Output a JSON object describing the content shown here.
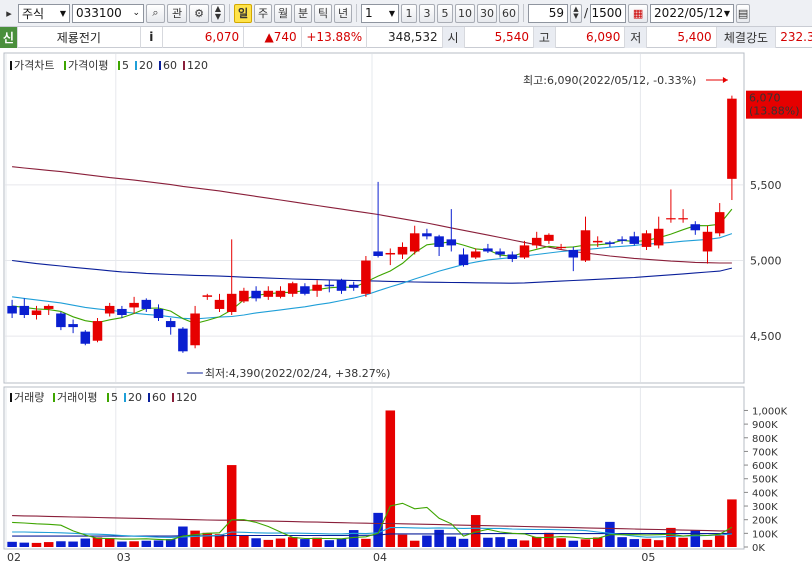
{
  "toolbar": {
    "market": "주식",
    "code": "033100",
    "btn_gwan": "관",
    "period_tabs": [
      {
        "label": "일",
        "active": true
      },
      {
        "label": "주",
        "active": false
      },
      {
        "label": "월",
        "active": false
      },
      {
        "label": "분",
        "active": false
      },
      {
        "label": "틱",
        "active": false
      },
      {
        "label": "년",
        "active": false
      }
    ],
    "interval": "1",
    "quick_counts": [
      "1",
      "3",
      "5",
      "10",
      "30",
      "60"
    ],
    "display_count": "59",
    "total_count": "1500",
    "date": "2022/05/12"
  },
  "quote": {
    "tag": "신",
    "name": "제룡전기",
    "info_btn": "i",
    "price": "6,070",
    "change": "▲740",
    "change_pct": "+13.88%",
    "volume": "348,532",
    "open_label": "시",
    "open": "5,540",
    "high_label": "고",
    "high": "6,090",
    "low_label": "저",
    "low": "5,400",
    "strength_label": "체결강도",
    "strength": "232.3"
  },
  "colors": {
    "up": "#e60000",
    "down": "#0a1fd0",
    "ma5": "#3ea500",
    "ma20": "#1f9fd8",
    "ma60": "#0a1f9a",
    "ma120": "#8a1f3a"
  },
  "chart_data": [
    {
      "type": "candlestick",
      "title": "가격차트",
      "legend": [
        {
          "name": "가격이평",
          "color": "#3ea500"
        },
        {
          "name": "5",
          "color": "#3ea500"
        },
        {
          "name": "20",
          "color": "#1f9fd8"
        },
        {
          "name": "60",
          "color": "#0a1f9a"
        },
        {
          "name": "120",
          "color": "#8a1f3a"
        }
      ],
      "y_ticks": [
        "5,500",
        "5,000",
        "4,500"
      ],
      "y_tick_values": [
        5500,
        5000,
        4500
      ],
      "ylim": [
        4250,
        6200
      ],
      "x_ticks": [
        {
          "label": "02",
          "index": 0
        },
        {
          "label": "03",
          "index": 9
        },
        {
          "label": "04",
          "index": 30
        },
        {
          "label": "05",
          "index": 52
        }
      ],
      "annotations": {
        "high": "최고:6,090(2022/05/12, -0.33%)",
        "low": "최저:4,390(2022/02/24, +38.27%)",
        "last_price": "6,070",
        "last_pct": "(13.88%)"
      },
      "candles": [
        {
          "o": 4700,
          "h": 4740,
          "l": 4620,
          "c": 4650
        },
        {
          "o": 4700,
          "h": 4750,
          "l": 4620,
          "c": 4640
        },
        {
          "o": 4640,
          "h": 4700,
          "l": 4610,
          "c": 4670
        },
        {
          "o": 4680,
          "h": 4710,
          "l": 4640,
          "c": 4700
        },
        {
          "o": 4650,
          "h": 4660,
          "l": 4540,
          "c": 4560
        },
        {
          "o": 4580,
          "h": 4610,
          "l": 4520,
          "c": 4560
        },
        {
          "o": 4530,
          "h": 4540,
          "l": 4440,
          "c": 4450
        },
        {
          "o": 4470,
          "h": 4620,
          "l": 4460,
          "c": 4600
        },
        {
          "o": 4650,
          "h": 4720,
          "l": 4630,
          "c": 4700
        },
        {
          "o": 4680,
          "h": 4700,
          "l": 4620,
          "c": 4640
        },
        {
          "o": 4690,
          "h": 4760,
          "l": 4650,
          "c": 4720
        },
        {
          "o": 4740,
          "h": 4750,
          "l": 4660,
          "c": 4680
        },
        {
          "o": 4680,
          "h": 4710,
          "l": 4600,
          "c": 4620
        },
        {
          "o": 4600,
          "h": 4620,
          "l": 4510,
          "c": 4560
        },
        {
          "o": 4550,
          "h": 4560,
          "l": 4390,
          "c": 4400
        },
        {
          "o": 4440,
          "h": 4700,
          "l": 4420,
          "c": 4650
        },
        {
          "o": 4760,
          "h": 4780,
          "l": 4740,
          "c": 4770
        },
        {
          "o": 4680,
          "h": 4780,
          "l": 4660,
          "c": 4740
        },
        {
          "o": 4660,
          "h": 5140,
          "l": 4640,
          "c": 4780
        },
        {
          "o": 4730,
          "h": 4820,
          "l": 4720,
          "c": 4800
        },
        {
          "o": 4800,
          "h": 4830,
          "l": 4730,
          "c": 4750
        },
        {
          "o": 4760,
          "h": 4830,
          "l": 4740,
          "c": 4800
        },
        {
          "o": 4760,
          "h": 4830,
          "l": 4750,
          "c": 4800
        },
        {
          "o": 4780,
          "h": 4860,
          "l": 4760,
          "c": 4850
        },
        {
          "o": 4830,
          "h": 4850,
          "l": 4770,
          "c": 4780
        },
        {
          "o": 4800,
          "h": 4870,
          "l": 4760,
          "c": 4840
        },
        {
          "o": 4840,
          "h": 4870,
          "l": 4790,
          "c": 4830
        },
        {
          "o": 4870,
          "h": 4880,
          "l": 4780,
          "c": 4800
        },
        {
          "o": 4840,
          "h": 4860,
          "l": 4800,
          "c": 4820
        },
        {
          "o": 4780,
          "h": 5030,
          "l": 4760,
          "c": 5000
        },
        {
          "o": 5060,
          "h": 5520,
          "l": 5020,
          "c": 5030
        },
        {
          "o": 5040,
          "h": 5080,
          "l": 4970,
          "c": 5050
        },
        {
          "o": 5040,
          "h": 5120,
          "l": 5010,
          "c": 5090
        },
        {
          "o": 5060,
          "h": 5230,
          "l": 5040,
          "c": 5180
        },
        {
          "o": 5180,
          "h": 5210,
          "l": 5140,
          "c": 5160
        },
        {
          "o": 5160,
          "h": 5170,
          "l": 5030,
          "c": 5090
        },
        {
          "o": 5140,
          "h": 5340,
          "l": 5060,
          "c": 5100
        },
        {
          "o": 5040,
          "h": 5080,
          "l": 4960,
          "c": 4970
        },
        {
          "o": 5020,
          "h": 5080,
          "l": 5010,
          "c": 5060
        },
        {
          "o": 5080,
          "h": 5110,
          "l": 5050,
          "c": 5060
        },
        {
          "o": 5060,
          "h": 5080,
          "l": 5020,
          "c": 5040
        },
        {
          "o": 5040,
          "h": 5060,
          "l": 4990,
          "c": 5010
        },
        {
          "o": 5020,
          "h": 5130,
          "l": 5010,
          "c": 5100
        },
        {
          "o": 5100,
          "h": 5190,
          "l": 5080,
          "c": 5150
        },
        {
          "o": 5130,
          "h": 5180,
          "l": 5110,
          "c": 5170
        },
        {
          "o": 5090,
          "h": 5110,
          "l": 5070,
          "c": 5090
        },
        {
          "o": 5070,
          "h": 5090,
          "l": 4930,
          "c": 5020
        },
        {
          "o": 5000,
          "h": 5290,
          "l": 4990,
          "c": 5200
        },
        {
          "o": 5120,
          "h": 5160,
          "l": 5090,
          "c": 5130
        },
        {
          "o": 5120,
          "h": 5130,
          "l": 5090,
          "c": 5110
        },
        {
          "o": 5140,
          "h": 5160,
          "l": 5110,
          "c": 5130
        },
        {
          "o": 5160,
          "h": 5190,
          "l": 5100,
          "c": 5110
        },
        {
          "o": 5090,
          "h": 5200,
          "l": 5070,
          "c": 5180
        },
        {
          "o": 5100,
          "h": 5290,
          "l": 5080,
          "c": 5210
        },
        {
          "o": 5280,
          "h": 5470,
          "l": 5250,
          "c": 5280
        },
        {
          "o": 5280,
          "h": 5340,
          "l": 5250,
          "c": 5280
        },
        {
          "o": 5240,
          "h": 5260,
          "l": 5170,
          "c": 5200
        },
        {
          "o": 5060,
          "h": 5230,
          "l": 4980,
          "c": 5190
        },
        {
          "o": 5180,
          "h": 5380,
          "l": 5160,
          "c": 5320
        },
        {
          "o": 5540,
          "h": 6090,
          "l": 5400,
          "c": 6070
        }
      ],
      "ma5": [
        4700,
        4690,
        4680,
        4676,
        4664,
        4628,
        4602,
        4590,
        4608,
        4622,
        4650,
        4684,
        4686,
        4666,
        4616,
        4584,
        4604,
        4628,
        4674,
        4741,
        4770,
        4780,
        4788,
        4790,
        4802,
        4808,
        4820,
        4826,
        4822,
        4858,
        4897,
        4931,
        4981,
        5052,
        5104,
        5114,
        5124,
        5102,
        5077,
        5070,
        5036,
        5029,
        5054,
        5074,
        5094,
        5086,
        5090,
        5102,
        5104,
        5111,
        5134,
        5125,
        5133,
        5150,
        5175,
        5204,
        5231,
        5230,
        5240,
        5340
      ],
      "ma20": [
        4760,
        4750,
        4740,
        4730,
        4720,
        4705,
        4690,
        4680,
        4672,
        4662,
        4652,
        4644,
        4638,
        4628,
        4618,
        4614,
        4620,
        4626,
        4630,
        4640,
        4654,
        4664,
        4674,
        4684,
        4694,
        4708,
        4720,
        4736,
        4752,
        4772,
        4800,
        4826,
        4850,
        4878,
        4904,
        4930,
        4952,
        4974,
        4990,
        5004,
        5012,
        5020,
        5030,
        5040,
        5050,
        5060,
        5066,
        5072,
        5080,
        5088,
        5094,
        5100,
        5108,
        5114,
        5120,
        5128,
        5134,
        5140,
        5150,
        5178
      ],
      "ma60": [
        5000,
        4990,
        4980,
        4972,
        4964,
        4955,
        4948,
        4940,
        4932,
        4925,
        4920,
        4915,
        4912,
        4908,
        4905,
        4902,
        4900,
        4897,
        4894,
        4890,
        4887,
        4884,
        4881,
        4878,
        4876,
        4874,
        4872,
        4870,
        4868,
        4866,
        4864,
        4862,
        4860,
        4858,
        4857,
        4856,
        4855,
        4854,
        4853,
        4852,
        4851,
        4850,
        4852,
        4856,
        4860,
        4864,
        4868,
        4872,
        4876,
        4880,
        4884,
        4888,
        4894,
        4900,
        4906,
        4912,
        4918,
        4924,
        4930,
        4950
      ],
      "ma120": [
        5620,
        5612,
        5604,
        5596,
        5588,
        5578,
        5568,
        5558,
        5548,
        5540,
        5532,
        5522,
        5512,
        5502,
        5490,
        5480,
        5470,
        5460,
        5448,
        5436,
        5424,
        5412,
        5400,
        5388,
        5376,
        5364,
        5352,
        5340,
        5328,
        5316,
        5304,
        5290,
        5276,
        5262,
        5248,
        5232,
        5216,
        5200,
        5184,
        5168,
        5152,
        5136,
        5120,
        5104,
        5088,
        5072,
        5060,
        5050,
        5040,
        5030,
        5022,
        5014,
        5008,
        5002,
        4996,
        4992,
        4988,
        4986,
        4984,
        4984
      ]
    },
    {
      "type": "bar",
      "title": "거래량",
      "legend": [
        {
          "name": "거래이평",
          "color": "#3ea500"
        },
        {
          "name": "5",
          "color": "#3ea500"
        },
        {
          "name": "20",
          "color": "#1f9fd8"
        },
        {
          "name": "60",
          "color": "#0a1f9a"
        },
        {
          "name": "120",
          "color": "#8a1f3a"
        }
      ],
      "y_ticks": [
        "1,000K",
        "900K",
        "800K",
        "700K",
        "600K",
        "500K",
        "400K",
        "300K",
        "200K",
        "100K",
        "0K"
      ],
      "y_tick_values": [
        1000000,
        900000,
        800000,
        700000,
        600000,
        500000,
        400000,
        300000,
        200000,
        100000,
        0
      ],
      "ylim": [
        0,
        1040000
      ],
      "volumes": [
        38000,
        32000,
        30000,
        36000,
        42000,
        40000,
        62000,
        70000,
        64000,
        40000,
        42000,
        46000,
        48000,
        58000,
        150000,
        120000,
        104000,
        94000,
        600000,
        88000,
        64000,
        52000,
        62000,
        72000,
        58000,
        68000,
        50000,
        60000,
        124000,
        60000,
        250000,
        1000000,
        90000,
        46000,
        84000,
        126000,
        76000,
        60000,
        234000,
        68000,
        72000,
        58000,
        48000,
        74000,
        104000,
        64000,
        46000,
        56000,
        70000,
        184000,
        72000,
        58000,
        60000,
        50000,
        140000,
        68000,
        120000,
        52000,
        84000,
        348532
      ],
      "ma5": [
        180000,
        176000,
        170000,
        166000,
        160000,
        118000,
        88000,
        64000,
        62000,
        58000,
        58000,
        60000,
        56000,
        52000,
        80000,
        90000,
        100000,
        104000,
        200000,
        200000,
        180000,
        150000,
        110000,
        70000,
        62000,
        62000,
        62000,
        60000,
        70000,
        75000,
        100000,
        300000,
        320000,
        280000,
        290000,
        210000,
        170000,
        80000,
        110000,
        130000,
        110000,
        100000,
        96000,
        68000,
        70000,
        76000,
        72000,
        62000,
        64000,
        90000,
        90000,
        90000,
        88000,
        90000,
        94000,
        80000,
        88000,
        84000,
        94000,
        144000
      ],
      "ma20": [
        110000,
        110000,
        108000,
        106000,
        104000,
        100000,
        96000,
        94000,
        90000,
        84000,
        80000,
        76000,
        72000,
        70000,
        74000,
        78000,
        82000,
        86000,
        110000,
        108000,
        104000,
        102000,
        102000,
        102000,
        100000,
        98000,
        96000,
        96000,
        100000,
        98000,
        104000,
        142000,
        142000,
        140000,
        138000,
        140000,
        138000,
        136000,
        138000,
        136000,
        136000,
        132000,
        130000,
        128000,
        128000,
        126000,
        124000,
        120000,
        110000,
        100000,
        90000,
        80000,
        72000,
        74000,
        78000,
        80000,
        82000,
        84000,
        88000,
        96000
      ],
      "ma60": [
        80000,
        80000,
        80000,
        80000,
        80000,
        80000,
        80000,
        80000,
        80000,
        80000,
        80000,
        80000,
        80000,
        80000,
        82000,
        82000,
        82000,
        82000,
        84000,
        84000,
        84000,
        84000,
        84000,
        84000,
        84000,
        84000,
        84000,
        84000,
        86000,
        86000,
        88000,
        96000,
        96000,
        96000,
        96000,
        96000,
        96000,
        96000,
        98000,
        98000,
        98000,
        98000,
        98000,
        98000,
        98000,
        98000,
        98000,
        98000,
        98000,
        98000,
        98000,
        98000,
        98000,
        98000,
        98000,
        98000,
        98000,
        98000,
        98000,
        100000
      ],
      "ma120": [
        230000,
        228000,
        226000,
        224000,
        222000,
        220000,
        218000,
        216000,
        214000,
        212000,
        210000,
        208000,
        206000,
        204000,
        202000,
        200000,
        198000,
        196000,
        196000,
        194000,
        192000,
        190000,
        188000,
        186000,
        184000,
        182000,
        180000,
        178000,
        176000,
        174000,
        172000,
        172000,
        170000,
        168000,
        166000,
        164000,
        162000,
        160000,
        158000,
        156000,
        154000,
        152000,
        150000,
        148000,
        146000,
        144000,
        142000,
        140000,
        138000,
        136000,
        134000,
        132000,
        130000,
        128000,
        126000,
        124000,
        122000,
        120000,
        118000,
        118000
      ]
    }
  ]
}
